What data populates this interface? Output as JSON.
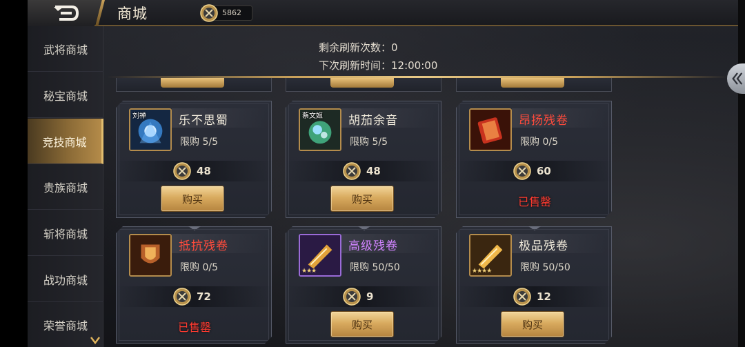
{
  "header": {
    "title": "商城",
    "currency_value": "5862"
  },
  "sidebar": {
    "items": [
      {
        "label": "武将商城",
        "active": false
      },
      {
        "label": "秘宝商城",
        "active": false
      },
      {
        "label": "竞技商城",
        "active": true
      },
      {
        "label": "贵族商城",
        "active": false
      },
      {
        "label": "斩将商城",
        "active": false
      },
      {
        "label": "战功商城",
        "active": false
      },
      {
        "label": "荣誉商城",
        "active": false
      }
    ]
  },
  "refresh": {
    "remaining_label": "剩余刷新次数：0",
    "next_time_label": "下次刷新时间：12:00:00"
  },
  "shop": {
    "items": [
      {
        "name": "乐不思蜀",
        "name_color": "normal",
        "tag": "刘禅",
        "limit": "限购  5/5",
        "price": "48",
        "action": "购买",
        "sold_out": false
      },
      {
        "name": "胡茄余音",
        "name_color": "normal",
        "tag": "蔡文姬",
        "limit": "限购  5/5",
        "price": "48",
        "action": "购买",
        "sold_out": false
      },
      {
        "name": "昂扬残卷",
        "name_color": "red",
        "tag": "",
        "limit": "限购  0/5",
        "price": "60",
        "action": "已售罄",
        "sold_out": true
      },
      {
        "name": "抵抗残卷",
        "name_color": "red",
        "tag": "",
        "limit": "限购  0/5",
        "price": "72",
        "action": "已售罄",
        "sold_out": true
      },
      {
        "name": "高级残卷",
        "name_color": "purple",
        "tag": "",
        "limit": "限购  50/50",
        "price": "9",
        "action": "购买",
        "sold_out": false
      },
      {
        "name": "极品残卷",
        "name_color": "normal",
        "tag": "",
        "limit": "限购  50/50",
        "price": "12",
        "action": "购买",
        "sold_out": false
      }
    ]
  },
  "colors": {
    "accent_gold": "#c9a15a",
    "sold_out_red": "#ff3b30",
    "rare_red": "#ff4b3c",
    "rare_purple": "#d084ff"
  },
  "icons": {
    "back": "back-arrow-icon",
    "currency": "crossed-swords-coin-icon",
    "collapse": "double-chevron-left-icon"
  }
}
